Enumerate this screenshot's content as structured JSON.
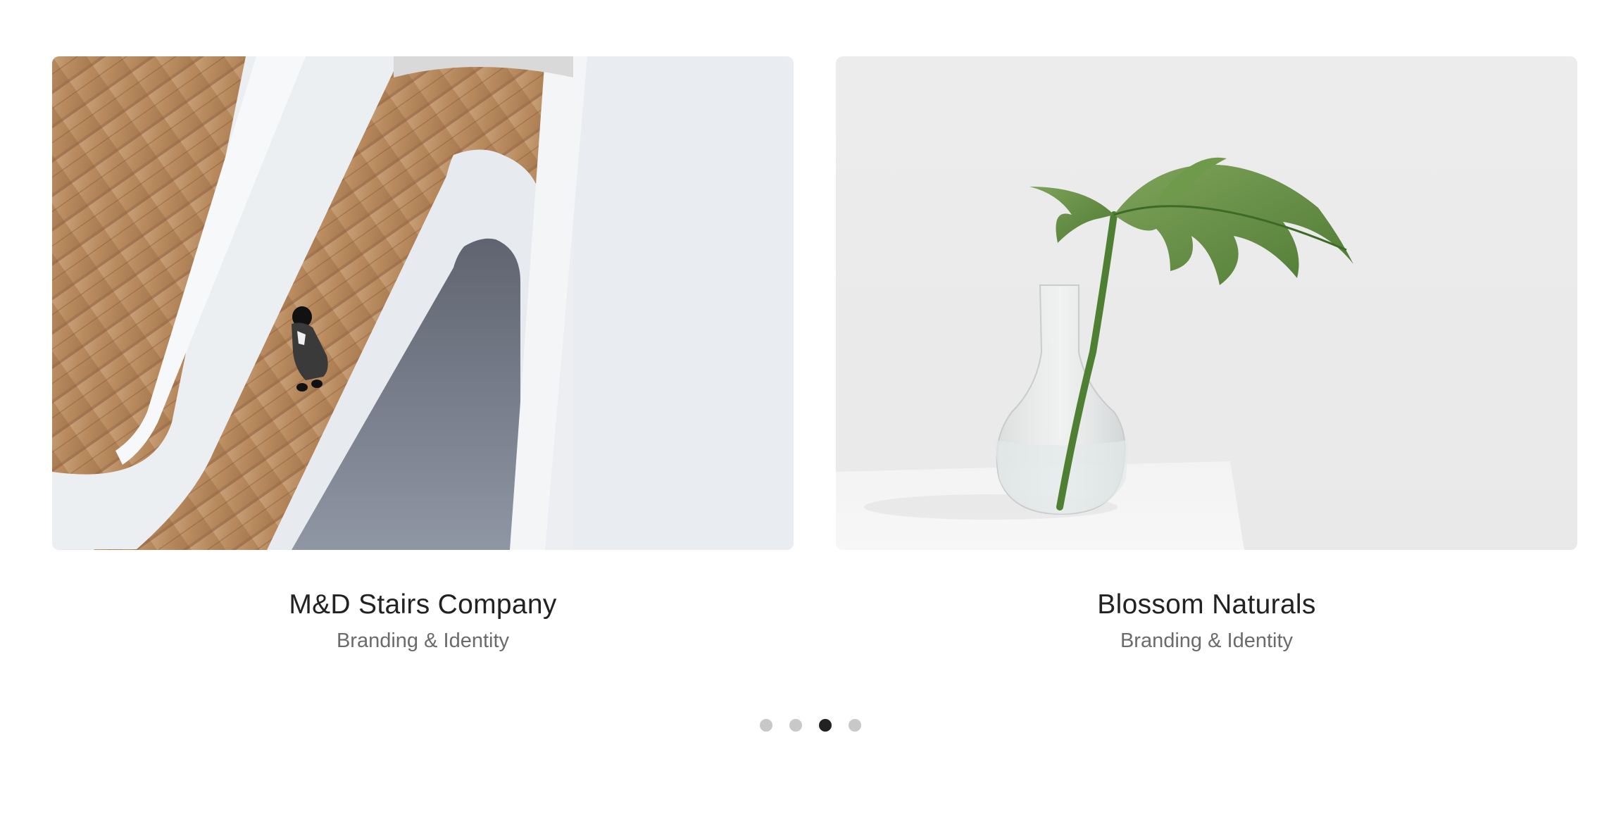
{
  "portfolio": {
    "items": [
      {
        "title": "M&D Stairs Company",
        "category": "Branding & Identity",
        "image": "spiral-staircase-photo"
      },
      {
        "title": "Blossom Naturals",
        "category": "Branding & Identity",
        "image": "monstera-leaf-vase-photo"
      }
    ]
  },
  "pagination": {
    "total": 4,
    "active_index": 2
  },
  "colors": {
    "title": "#222222",
    "subtitle": "#6b6b6b",
    "dot_inactive": "#c8c8c8",
    "dot_active": "#222222"
  }
}
